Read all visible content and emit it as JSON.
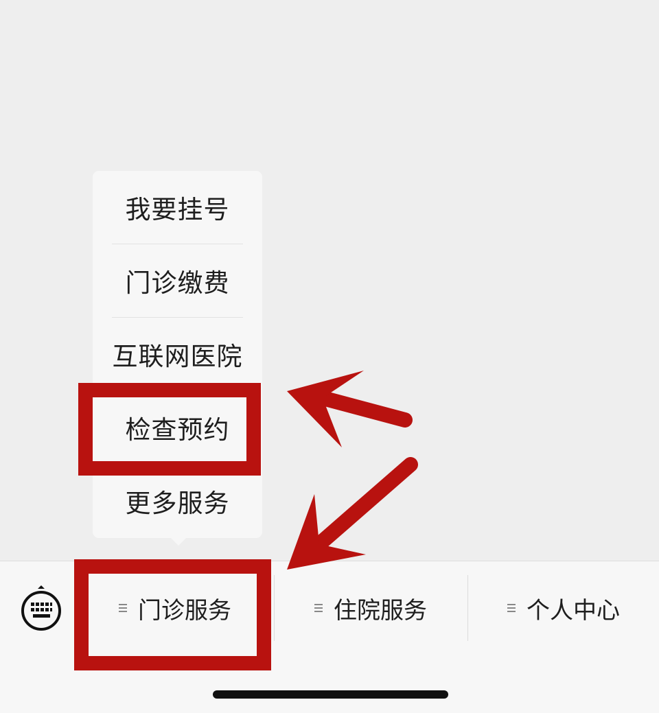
{
  "popup_menu": {
    "items": [
      {
        "label": "我要挂号"
      },
      {
        "label": "门诊缴费"
      },
      {
        "label": "互联网医院"
      },
      {
        "label": "检查预约"
      },
      {
        "label": "更多服务"
      }
    ]
  },
  "bottom_menu": {
    "keyboard_icon": "keyboard-icon",
    "tabs": [
      {
        "label": "门诊服务",
        "icon": "menu-lines-icon"
      },
      {
        "label": "住院服务",
        "icon": "menu-lines-icon"
      },
      {
        "label": "个人中心",
        "icon": "menu-lines-icon"
      }
    ]
  },
  "annotations": {
    "color": "#b8120f",
    "highlighted_item": "检查预约",
    "highlighted_tab": "门诊服务"
  }
}
